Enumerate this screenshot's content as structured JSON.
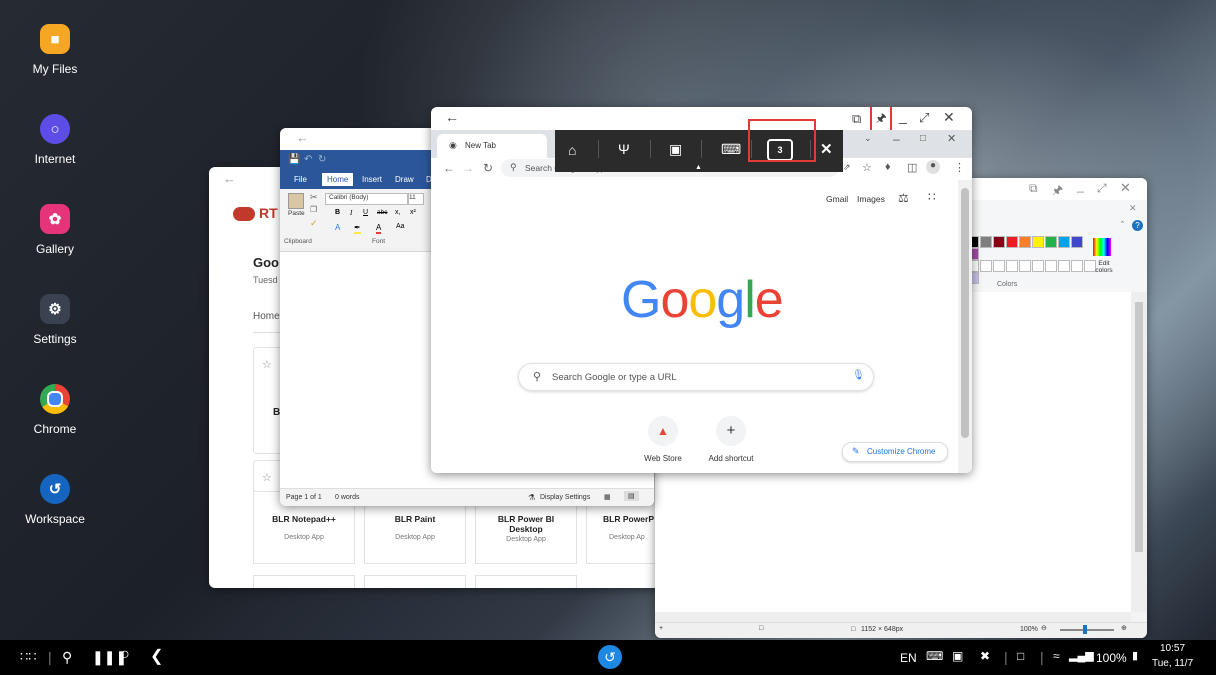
{
  "desktop": {
    "icons": [
      {
        "label": "My Files",
        "color": "#f5a623"
      },
      {
        "label": "Internet",
        "color": "#5b4de6"
      },
      {
        "label": "Gallery",
        "color": "#e5347a"
      },
      {
        "label": "Settings",
        "color": "#3a4150"
      },
      {
        "label": "Chrome",
        "color": "#ffffff"
      },
      {
        "label": "Workspace",
        "color": "#1565c0"
      }
    ]
  },
  "rt_window": {
    "logo_text": "RT",
    "heading": "Goo",
    "date": "Tuesd",
    "tab": "Home",
    "apps": [
      {
        "name": "BLR Notepad++",
        "type": "Desktop App"
      },
      {
        "name": "BLR Paint",
        "type": "Desktop App"
      },
      {
        "name": "BLR Power BI Desktop",
        "type": "Desktop App"
      },
      {
        "name": "BLR PowerP",
        "type": "Desktop Ap"
      }
    ],
    "card_letter": "B"
  },
  "word": {
    "tabs": [
      "File",
      "Home",
      "Insert",
      "Draw",
      "D"
    ],
    "font_name": "Calibri (Body)",
    "font_size": "11",
    "paste": "Paste",
    "clipboard": "Clipboard",
    "font_group": "Font",
    "status_page": "Page 1 of 1",
    "status_words": "0 words",
    "display_settings": "Display Settings"
  },
  "paint": {
    "edit_colors": "Edit colors",
    "colors_group": "Colors",
    "dimensions": "1152 × 648px",
    "zoom": "100%",
    "palette": [
      "#000000",
      "#7f7f7f",
      "#880015",
      "#ed1c24",
      "#ff7f27",
      "#fff200",
      "#22b14c",
      "#00a2e8",
      "#3f48cc",
      "#a349a4",
      "#ffffff",
      "#c3c3c3",
      "#b97a57",
      "#ffaec9",
      "#ffc90e",
      "#efe4b0",
      "#b5e61d",
      "#99d9ea",
      "#7092be",
      "#c8bfe7"
    ]
  },
  "chrome": {
    "tab_title": "New Tab",
    "omnibox_placeholder": "Search Google or type a URL",
    "top_links": [
      "Gmail",
      "Images"
    ],
    "logo_letters": [
      "G",
      "o",
      "o",
      "g",
      "l",
      "e"
    ],
    "logo_colors": [
      "#4285f4",
      "#ea4335",
      "#fbbc05",
      "#4285f4",
      "#34a853",
      "#ea4335"
    ],
    "search_placeholder": "Search Google or type a URL",
    "shortcuts": [
      {
        "label": "Web Store"
      },
      {
        "label": "Add shortcut"
      }
    ],
    "customize": "Customize Chrome",
    "multiwindow_count": "3"
  },
  "taskbar": {
    "lang": "EN",
    "battery": "100%",
    "time": "10:57",
    "date": "Tue, 11/7"
  }
}
